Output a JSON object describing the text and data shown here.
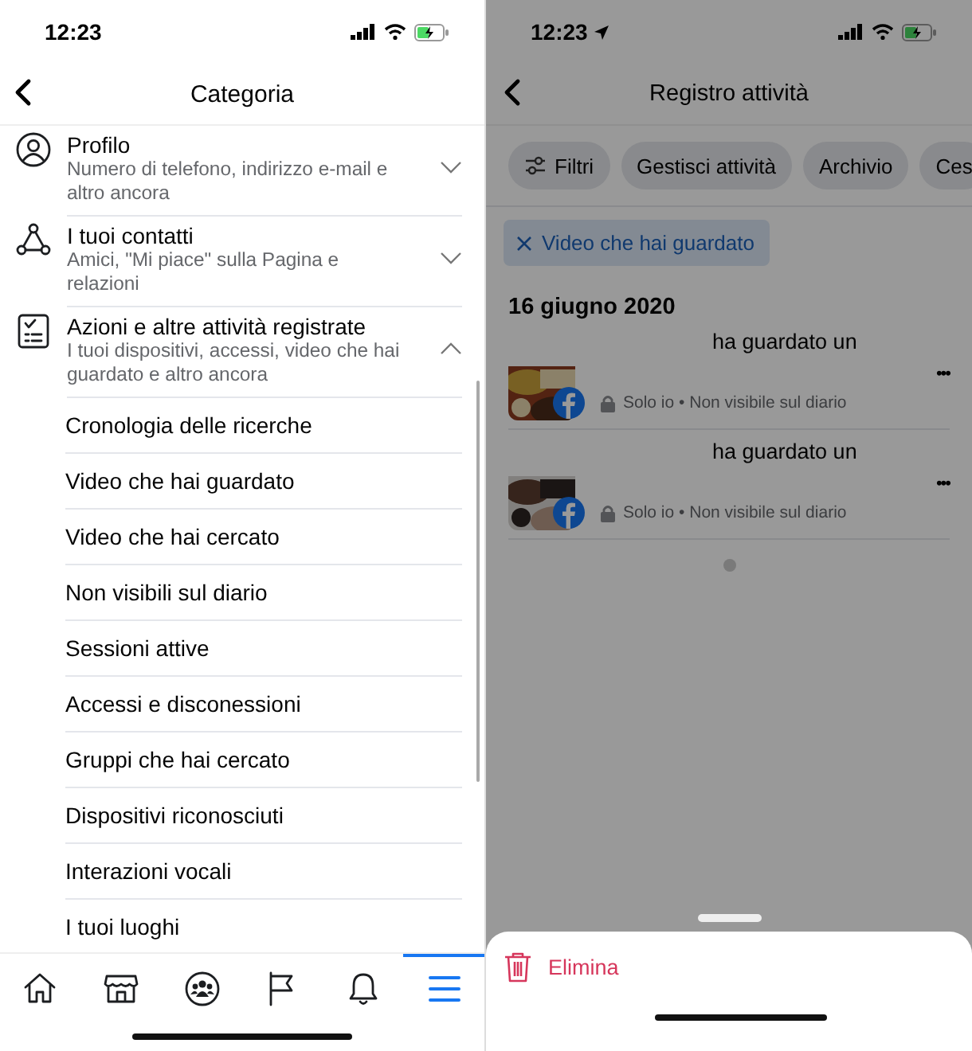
{
  "left": {
    "status_bar": {
      "time": "12:23",
      "location": false
    },
    "header": {
      "title": "Categoria"
    },
    "sections": [
      {
        "kind": "profile",
        "title": "Profilo",
        "subtitle": "Numero di telefono, indirizzo e-mail e altro ancora",
        "expanded": false
      },
      {
        "kind": "contacts",
        "title": "I tuoi contatti",
        "subtitle": "Amici, \"Mi piace\" sulla Pagina e relazioni",
        "expanded": false
      },
      {
        "kind": "actions",
        "title": "Azioni e altre attività registrate",
        "subtitle": "I tuoi dispositivi, accessi, video che hai guardato e altro ancora",
        "expanded": true,
        "children": [
          {
            "label": "Cronologia delle ricerche"
          },
          {
            "label": "Video che hai guardato"
          },
          {
            "label": "Video che hai cercato"
          },
          {
            "label": "Non visibili sul diario"
          },
          {
            "label": "Sessioni attive"
          },
          {
            "label": "Accessi e disconessioni"
          },
          {
            "label": "Gruppi che hai cercato"
          },
          {
            "label": "Dispositivi riconosciuti"
          },
          {
            "label": "Interazioni vocali"
          },
          {
            "label": "I tuoi luoghi"
          }
        ]
      }
    ],
    "tab_bar": [
      {
        "kind": "home",
        "selected": false
      },
      {
        "kind": "marketplace",
        "selected": false
      },
      {
        "kind": "groups",
        "selected": false
      },
      {
        "kind": "pages",
        "selected": false
      },
      {
        "kind": "notifications",
        "selected": false
      },
      {
        "kind": "menu",
        "selected": true
      }
    ]
  },
  "right": {
    "status_bar": {
      "time": "12:23",
      "location": true
    },
    "header": {
      "title": "Registro attività"
    },
    "chips": [
      {
        "kind": "filter",
        "label": "Filtri"
      },
      {
        "kind": "plain",
        "label": "Gestisci attività"
      },
      {
        "kind": "plain",
        "label": "Archivio"
      },
      {
        "kind": "plain",
        "label": "Ces"
      }
    ],
    "active_filter": {
      "label": "Video che hai guardato"
    },
    "date": "16 giugno 2020",
    "entries": [
      {
        "text": "ha guardato un",
        "privacy": "Solo io • Non visibile sul diario",
        "more": "•••"
      },
      {
        "text": "ha guardato un",
        "privacy": "Solo io • Non visibile sul diario",
        "more": "•••"
      }
    ],
    "dimmed": true,
    "sheet": {
      "action": "Elimina"
    }
  }
}
